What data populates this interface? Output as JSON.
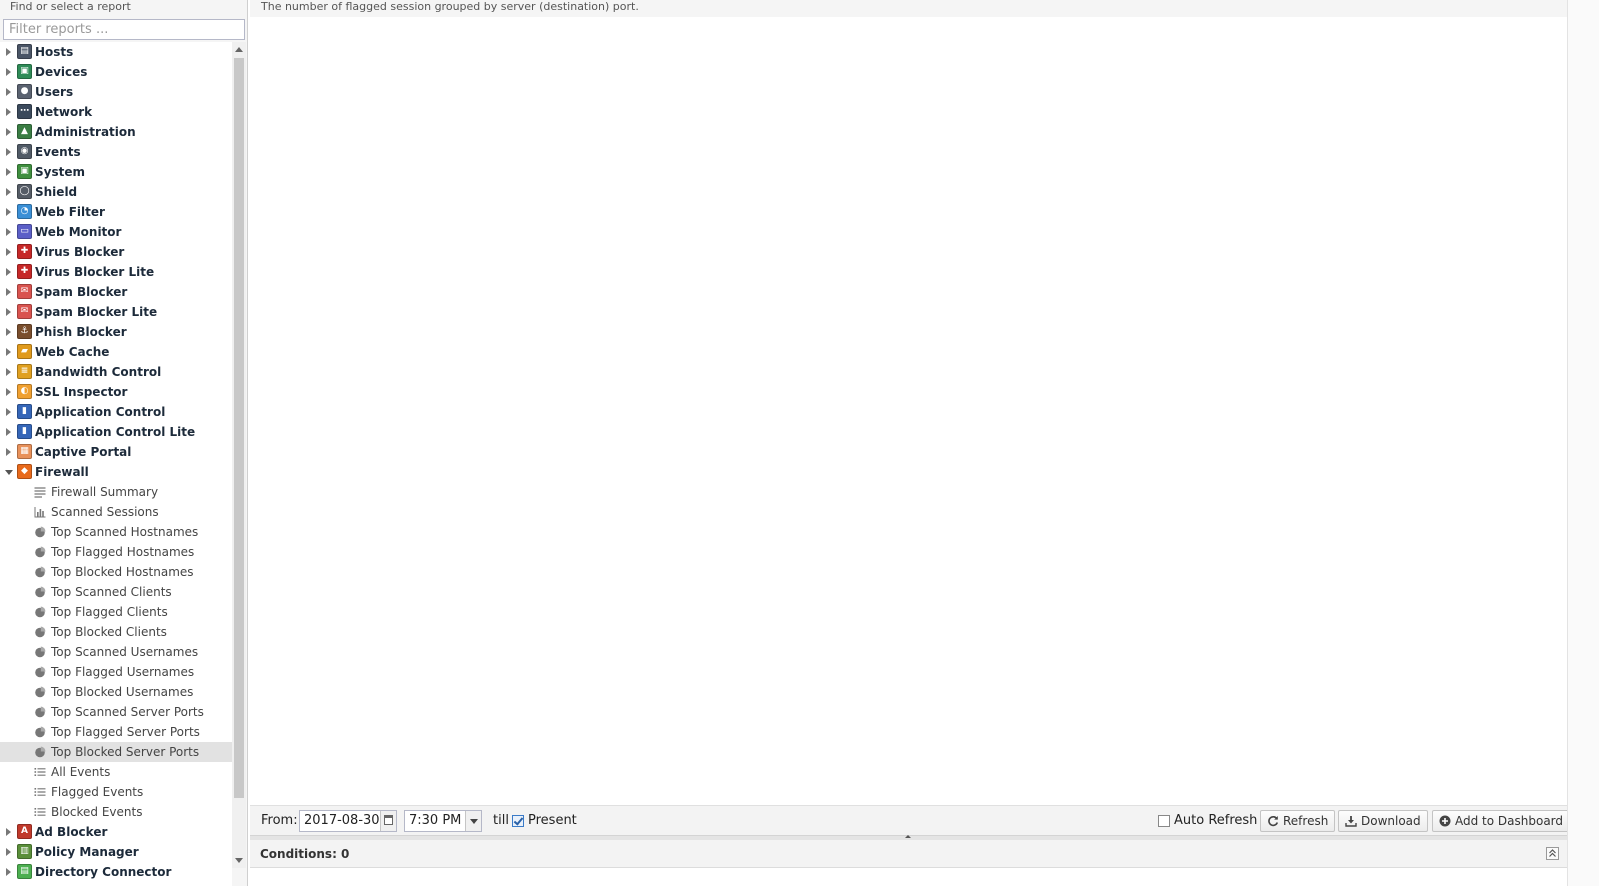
{
  "sidebar": {
    "header": "Find or select a report",
    "filter_placeholder": "Filter reports ...",
    "categories_top": [
      {
        "label": "Hosts",
        "icon": "hosts-icon",
        "color": "#4a5566",
        "glyph": "▤"
      },
      {
        "label": "Devices",
        "icon": "devices-icon",
        "color": "#2e8b57",
        "glyph": "▣"
      },
      {
        "label": "Users",
        "icon": "users-icon",
        "color": "#5a6270",
        "glyph": "●"
      },
      {
        "label": "Network",
        "icon": "network-icon",
        "color": "#3b4a5c",
        "glyph": "⋯"
      },
      {
        "label": "Administration",
        "icon": "administration-icon",
        "color": "#3a7d44",
        "glyph": "▲"
      },
      {
        "label": "Events",
        "icon": "events-icon",
        "color": "#505a66",
        "glyph": "◉"
      },
      {
        "label": "System",
        "icon": "system-icon",
        "color": "#3f8f3f",
        "glyph": "▣"
      },
      {
        "label": "Shield",
        "icon": "shield-icon",
        "color": "#555c66",
        "glyph": "◯"
      },
      {
        "label": "Web Filter",
        "icon": "web-filter-icon",
        "color": "#3a8fd6",
        "glyph": "◔"
      },
      {
        "label": "Web Monitor",
        "icon": "web-monitor-icon",
        "color": "#5b5fc7",
        "glyph": "▭"
      },
      {
        "label": "Virus Blocker",
        "icon": "virus-blocker-icon",
        "color": "#c62828",
        "glyph": "✚"
      },
      {
        "label": "Virus Blocker Lite",
        "icon": "virus-blocker-lite-icon",
        "color": "#c62828",
        "glyph": "✚"
      },
      {
        "label": "Spam Blocker",
        "icon": "spam-blocker-icon",
        "color": "#d9534f",
        "glyph": "✉"
      },
      {
        "label": "Spam Blocker Lite",
        "icon": "spam-blocker-lite-icon",
        "color": "#d9534f",
        "glyph": "✉"
      },
      {
        "label": "Phish Blocker",
        "icon": "phish-blocker-icon",
        "color": "#7a4e2d",
        "glyph": "⚓"
      },
      {
        "label": "Web Cache",
        "icon": "web-cache-icon",
        "color": "#e09a1c",
        "glyph": "▰"
      },
      {
        "label": "Bandwidth Control",
        "icon": "bandwidth-control-icon",
        "color": "#e0a020",
        "glyph": "≡"
      },
      {
        "label": "SSL Inspector",
        "icon": "ssl-inspector-icon",
        "color": "#f0a030",
        "glyph": "◐"
      },
      {
        "label": "Application Control",
        "icon": "application-control-icon",
        "color": "#3566b8",
        "glyph": "▮"
      },
      {
        "label": "Application Control Lite",
        "icon": "application-control-lite-icon",
        "color": "#3566b8",
        "glyph": "▮"
      },
      {
        "label": "Captive Portal",
        "icon": "captive-portal-icon",
        "color": "#e8915a",
        "glyph": "▦"
      }
    ],
    "firewall": {
      "label": "Firewall",
      "icon": "firewall-icon",
      "color": "#e86a1c",
      "glyph": "◆",
      "reports": [
        {
          "label": "Firewall Summary",
          "icon": "text-lines-icon"
        },
        {
          "label": "Scanned Sessions",
          "icon": "bar-chart-icon"
        },
        {
          "label": "Top Scanned Hostnames",
          "icon": "pie-chart-icon"
        },
        {
          "label": "Top Flagged Hostnames",
          "icon": "pie-chart-icon"
        },
        {
          "label": "Top Blocked Hostnames",
          "icon": "pie-chart-icon"
        },
        {
          "label": "Top Scanned Clients",
          "icon": "pie-chart-icon"
        },
        {
          "label": "Top Flagged Clients",
          "icon": "pie-chart-icon"
        },
        {
          "label": "Top Blocked Clients",
          "icon": "pie-chart-icon"
        },
        {
          "label": "Top Scanned Usernames",
          "icon": "pie-chart-icon"
        },
        {
          "label": "Top Flagged Usernames",
          "icon": "pie-chart-icon"
        },
        {
          "label": "Top Blocked Usernames",
          "icon": "pie-chart-icon"
        },
        {
          "label": "Top Scanned Server Ports",
          "icon": "pie-chart-icon"
        },
        {
          "label": "Top Flagged Server Ports",
          "icon": "pie-chart-icon"
        },
        {
          "label": "Top Blocked Server Ports",
          "icon": "pie-chart-icon",
          "selected": true
        },
        {
          "label": "All Events",
          "icon": "list-icon"
        },
        {
          "label": "Flagged Events",
          "icon": "list-icon"
        },
        {
          "label": "Blocked Events",
          "icon": "list-icon"
        }
      ]
    },
    "categories_bottom": [
      {
        "label": "Ad Blocker",
        "icon": "ad-blocker-icon",
        "color": "#c0392b",
        "glyph": "A"
      },
      {
        "label": "Policy Manager",
        "icon": "policy-manager-icon",
        "color": "#5a8f3a",
        "glyph": "▥"
      },
      {
        "label": "Directory Connector",
        "icon": "directory-connector-icon",
        "color": "#4caf50",
        "glyph": "▤"
      }
    ]
  },
  "main": {
    "description": "The number of flagged session grouped by server (destination) port."
  },
  "toolbar": {
    "from_label": "From:",
    "from_date": "2017-08-30",
    "from_time": "7:30 PM",
    "till_label": "till",
    "present_label": "Present",
    "present_checked": true,
    "auto_refresh_label": "Auto Refresh",
    "auto_refresh_checked": false,
    "refresh_label": "Refresh",
    "download_label": "Download",
    "add_dashboard_label": "Add to Dashboard"
  },
  "conditions": {
    "label": "Conditions: 0"
  }
}
